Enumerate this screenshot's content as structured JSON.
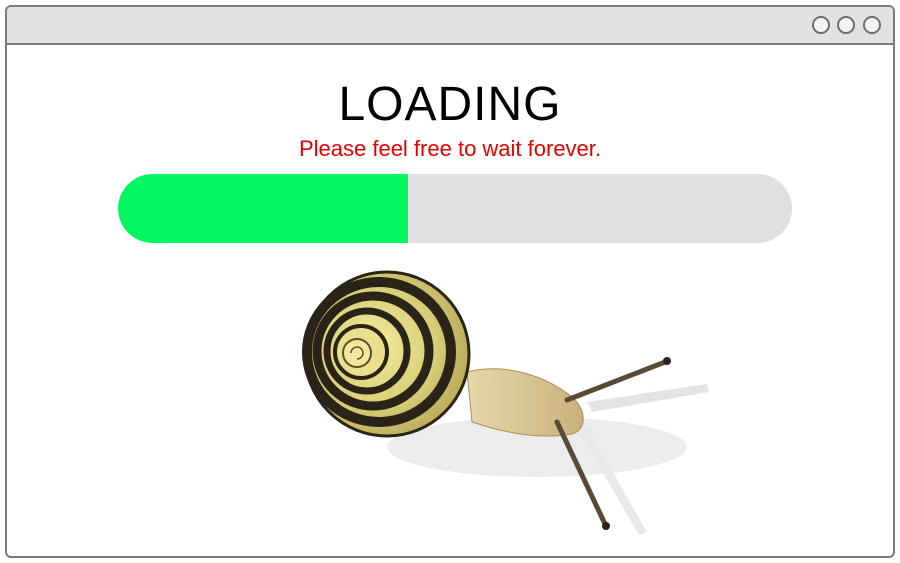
{
  "window": {
    "controls": [
      "circle-button",
      "circle-button",
      "circle-button"
    ]
  },
  "main": {
    "title": "LOADING",
    "subtitle": "Please feel free to wait forever."
  },
  "progress": {
    "fraction": 0.43
  },
  "colors": {
    "subtitle": "#e60000",
    "progress_fill": "#00f75f",
    "progress_track": "#e0e0e0"
  },
  "illustration": {
    "icon": "snail-image"
  }
}
